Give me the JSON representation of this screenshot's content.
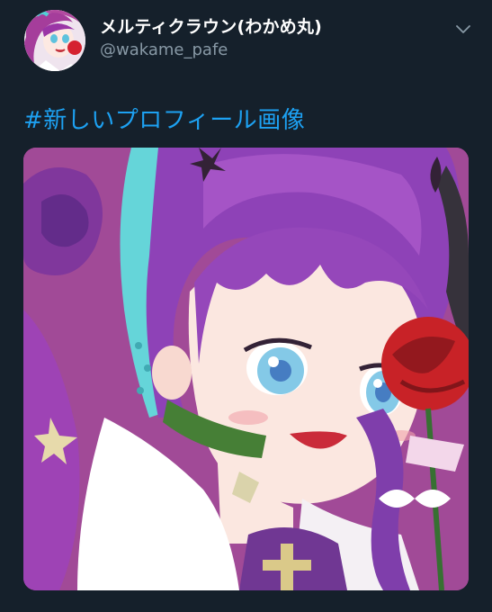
{
  "tweet": {
    "author": {
      "display_name": "メルティクラウン(わかめ丸)",
      "handle": "@wakame_pafe",
      "avatar_icon": "profile-avatar-illustration"
    },
    "menu_icon": "chevron-down-icon",
    "body_text": "#新しいプロフィール画像",
    "media": {
      "kind": "illustration",
      "subject": "anime-girl-purple-hair-red-rose",
      "colors": {
        "background": "#a6468e",
        "hair": "#8a3bb5",
        "skin": "#fbe6df",
        "rose": "#c61a1f",
        "choker": "#3f7a2e",
        "accent_cyan": "#5fd4d8"
      }
    }
  },
  "theme": {
    "background": "#15202b",
    "text_primary": "#ffffff",
    "text_secondary": "#8899a6",
    "link": "#1da1f2"
  }
}
